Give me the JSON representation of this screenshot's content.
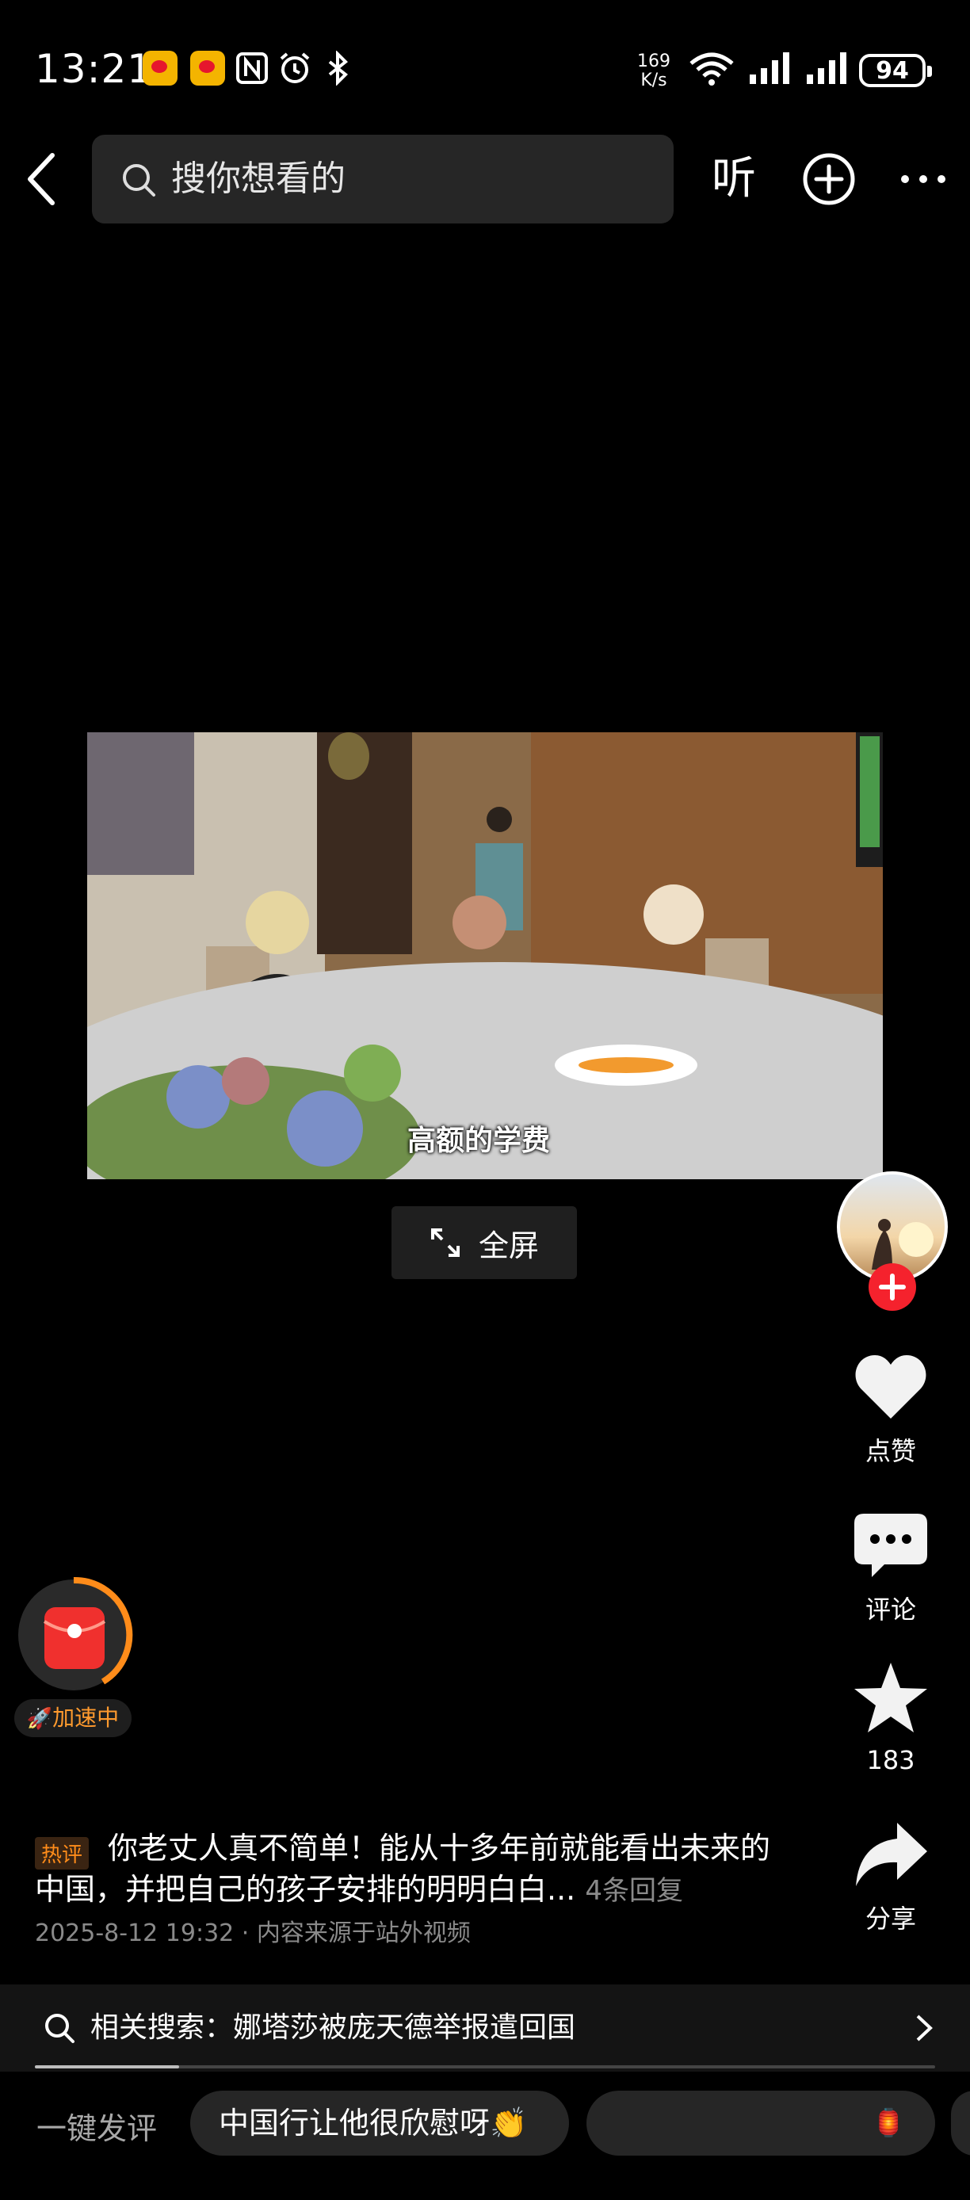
{
  "status_bar": {
    "time": "13:21",
    "net_speed_value": "169",
    "net_speed_unit": "K/s",
    "battery": "94",
    "icons": [
      "weibo-app-icon",
      "weibo-app-icon",
      "nfc-icon",
      "alarm-icon",
      "bluetooth-icon",
      "wifi-icon",
      "signal-icon",
      "signal-icon",
      "battery-icon"
    ]
  },
  "header": {
    "search_placeholder": "搜你想看的",
    "listen_label": "听",
    "icons": [
      "back-arrow-icon",
      "search-icon",
      "add-circle-icon",
      "more-dots-icon"
    ]
  },
  "video": {
    "subtitle": "高额的学费",
    "fullscreen_label": "全屏"
  },
  "side_actions": {
    "like_label": "点赞",
    "comment_label": "评论",
    "favorite_count": "183",
    "share_label": "分享"
  },
  "widget": {
    "speed_label": "加速中"
  },
  "comment": {
    "tag": "热评",
    "text": "你老丈人真不简单！能从十多年前就能看出未来的中国，并把自己的孩子安排的明明白白...",
    "replies": "4条回复",
    "date": "2025-8-12 19:32",
    "separator": "·",
    "source": "内容来源于站外视频"
  },
  "related_search": {
    "label": "相关搜索：",
    "query": "娜塔莎被庞天德举报遣回国",
    "progress": 0.16
  },
  "bottom_bar": {
    "quick_comment_label": "一键发评",
    "chips": [
      "中国行让他很欣慰呀👏"
    ]
  },
  "colors": {
    "background": "#000000",
    "accent_red": "#f5222d",
    "hot_orange": "#ff8c1a"
  }
}
